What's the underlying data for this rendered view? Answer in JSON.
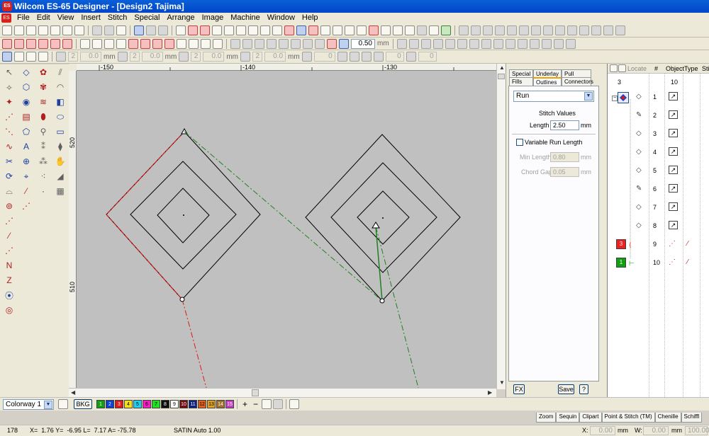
{
  "window": {
    "title": "Wilcom ES-65 Designer - [Design2          Tajima]",
    "app_icon_text": "ES"
  },
  "menu": [
    "File",
    "Edit",
    "View",
    "Insert",
    "Stitch",
    "Special",
    "Arrange",
    "Image",
    "Machine",
    "Window",
    "Help"
  ],
  "toolbar2": {
    "value": "0.50",
    "unit": "mm"
  },
  "toolbar3": {
    "fields": [
      {
        "count": "2",
        "value": "0.0"
      },
      {
        "count": "2",
        "value": "0.0"
      },
      {
        "count": "2",
        "value": "0.0"
      },
      {
        "count": "2",
        "value": "0.0"
      }
    ],
    "mm": "mm",
    "angle_value": "0",
    "angle_value2": "0"
  },
  "rulers": {
    "h_labels": [
      "-150",
      "-140",
      "-130"
    ],
    "v_labels": [
      "520",
      "510"
    ]
  },
  "panel": {
    "tabs_top": [
      "Special",
      "Underlay",
      "Pull Comp"
    ],
    "tabs_bottom": [
      "Fills",
      "Outlines",
      "Connectors"
    ],
    "stitch_type": "Run",
    "stitch_values_label": "Stitch Values",
    "length_label": "Length",
    "length_value": "2.50",
    "length_unit": "mm",
    "variable_run_label": "Variable Run Length",
    "min_length_label": "Min Length",
    "min_length_value": "0.80",
    "chord_gap_label": "Chord Gap",
    "chord_gap_value": "0.05",
    "fx_label": "FX",
    "save_label": "Save",
    "help_label": "?"
  },
  "object_list": {
    "locate_label": "Locate",
    "col_num": "#",
    "col_object": "Object",
    "col_type": "Type",
    "col_stitch": "Stit",
    "group_count": "3",
    "group_num": "10",
    "rows": [
      {
        "num": "1",
        "kind": "diamond"
      },
      {
        "num": "2",
        "kind": "pencil"
      },
      {
        "num": "3",
        "kind": "diamond"
      },
      {
        "num": "4",
        "kind": "diamond"
      },
      {
        "num": "5",
        "kind": "diamond"
      },
      {
        "num": "6",
        "kind": "pencil"
      },
      {
        "num": "7",
        "kind": "diamond"
      },
      {
        "num": "8",
        "kind": "diamond"
      },
      {
        "num": "9",
        "kind": "red",
        "chip": "3",
        "chip_color": "#ee2020"
      },
      {
        "num": "10",
        "kind": "green",
        "chip": "1",
        "chip_color": "#10a010"
      }
    ]
  },
  "colorway": {
    "name": "Colorway 1",
    "bkg_label": "BKG",
    "chips": [
      {
        "n": "1",
        "color": "#10a010"
      },
      {
        "n": "2",
        "color": "#1040d0"
      },
      {
        "n": "3",
        "color": "#e01818"
      },
      {
        "n": "4",
        "color": "#f0e020"
      },
      {
        "n": "5",
        "color": "#20d0f0"
      },
      {
        "n": "6",
        "color": "#f020c0"
      },
      {
        "n": "7",
        "color": "#20e020"
      },
      {
        "n": "8",
        "color": "#101010"
      },
      {
        "n": "9",
        "color": "#ffffff"
      },
      {
        "n": "10",
        "color": "#701010"
      },
      {
        "n": "11",
        "color": "#102080"
      },
      {
        "n": "12",
        "color": "#e06020"
      },
      {
        "n": "13",
        "color": "#e0a020"
      },
      {
        "n": "14",
        "color": "#a07030"
      },
      {
        "n": "15",
        "color": "#c040c0"
      }
    ],
    "plus": "+",
    "minus": "−"
  },
  "bottom_tabs": [
    "Zoom",
    "Sequin",
    "Clipart",
    "Point & Stitch (TM)",
    "Chenille",
    "Schiffl"
  ],
  "status": {
    "stitch_count": "178",
    "coords": "X=  1.76 Y=  -6.95 L=  7.17 A= -75.78",
    "mode": "SATIN Auto  1.00",
    "x_label": "X:",
    "x_value": "0.00",
    "x_unit": "mm",
    "w_label": "W:",
    "w_value": "0.00",
    "w_unit": "mm",
    "pct": "100.00"
  }
}
